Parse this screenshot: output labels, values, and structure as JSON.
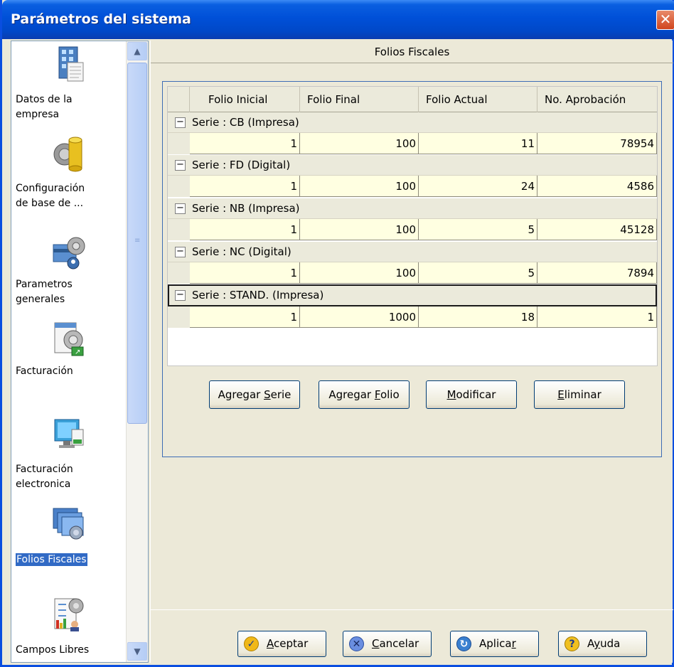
{
  "window": {
    "title": "Parámetros del sistema",
    "close_label": "✕"
  },
  "sidebar": {
    "items": [
      {
        "label_line1": "Datos de la",
        "label_line2": "empresa",
        "icon": "building-document-icon"
      },
      {
        "label_line1": "Configuración",
        "label_line2": "de base de ...",
        "icon": "database-icon"
      },
      {
        "label_line1": "Parametros",
        "label_line2": "generales",
        "icon": "settings-card-icon"
      },
      {
        "label_line1": "Facturación",
        "label_line2": "",
        "icon": "invoice-icon"
      },
      {
        "label_line1": "Facturación",
        "label_line2": "electronica",
        "icon": "electronic-invoice-icon"
      },
      {
        "label_line1": "Folios Fiscales",
        "label_line2": "",
        "icon": "fiscal-folios-icon",
        "selected": true
      },
      {
        "label_line1": "Campos Libres",
        "label_line2": "",
        "icon": "free-fields-icon"
      }
    ]
  },
  "panel": {
    "header": "Folios Fiscales",
    "columns": [
      "Folio Inicial",
      "Folio Final",
      "Folio Actual",
      "No. Aprobación"
    ],
    "series": [
      {
        "label": "Serie : CB (Impresa)",
        "folio_inicial": "1",
        "folio_final": "100",
        "folio_actual": "11",
        "aprobacion": "78954"
      },
      {
        "label": "Serie : FD (Digital)",
        "folio_inicial": "1",
        "folio_final": "100",
        "folio_actual": "24",
        "aprobacion": "4586"
      },
      {
        "label": "Serie : NB (Impresa)",
        "folio_inicial": "1",
        "folio_final": "100",
        "folio_actual": "5",
        "aprobacion": "45128"
      },
      {
        "label": "Serie : NC (Digital)",
        "folio_inicial": "1",
        "folio_final": "100",
        "folio_actual": "5",
        "aprobacion": "7894"
      },
      {
        "label": "Serie : STAND. (Impresa)",
        "folio_inicial": "1",
        "folio_final": "1000",
        "folio_actual": "18",
        "aprobacion": "1"
      }
    ],
    "buttons": {
      "agregar_serie_pre": "Agregar ",
      "agregar_serie_key": "S",
      "agregar_serie_post": "erie",
      "agregar_folio_pre": "Agregar ",
      "agregar_folio_key": "F",
      "agregar_folio_post": "olio",
      "modificar_key": "M",
      "modificar_post": "odificar",
      "eliminar_key": "E",
      "eliminar_post": "liminar"
    }
  },
  "footer": {
    "aceptar_key": "A",
    "aceptar_post": "ceptar",
    "cancelar_key": "C",
    "cancelar_post": "ancelar",
    "aplicar_pre": "Aplica",
    "aplicar_key": "r",
    "ayuda_pre": "A",
    "ayuda_key": "y",
    "ayuda_post": "uda"
  },
  "colors": {
    "title_bar": "#0050d8",
    "selected": "#316ac5",
    "row_fill": "#ffffe1",
    "close": "#d0451e"
  }
}
